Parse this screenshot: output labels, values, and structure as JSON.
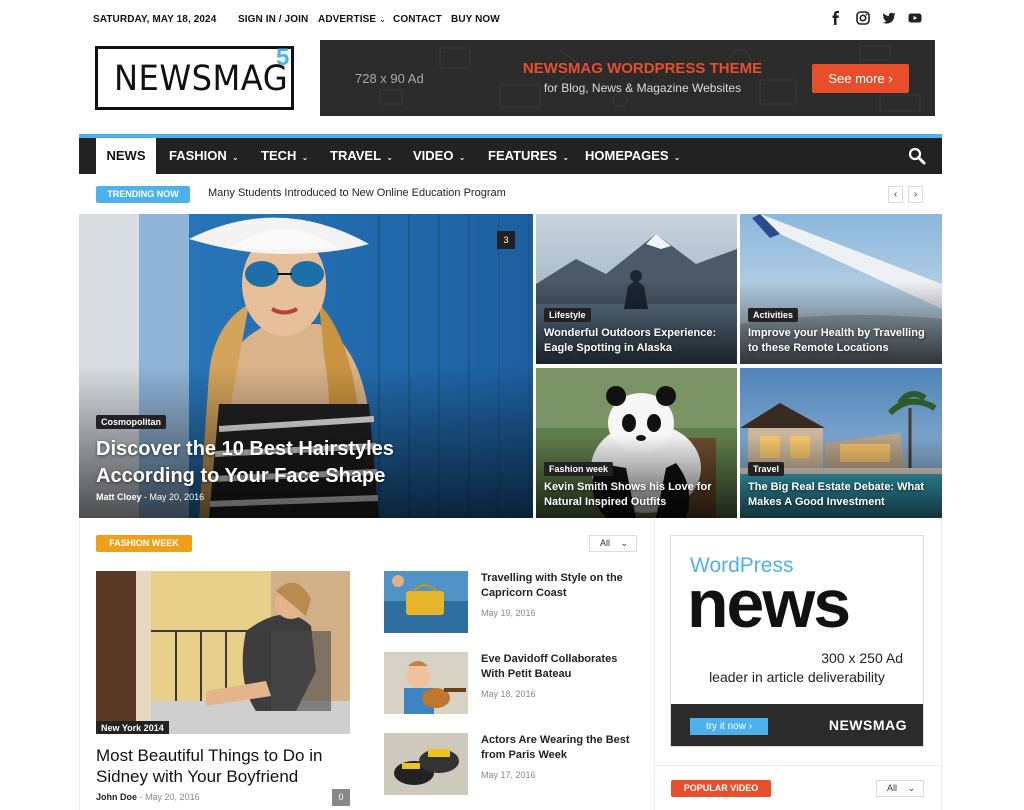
{
  "topbar": {
    "date": "SATURDAY, MAY 18, 2024",
    "links": [
      "SIGN IN / JOIN",
      "ADVERTISE",
      "CONTACT",
      "BUY NOW"
    ],
    "social_icons": [
      "facebook-icon",
      "instagram-icon",
      "twitter-icon",
      "youtube-icon"
    ]
  },
  "logo": {
    "text": "NEWSMAG",
    "sup": "5"
  },
  "ad_banner": {
    "size": "728 x 90 Ad",
    "title": "NEWSMAG WORDPRESS THEME",
    "subtitle": "for Blog, News & Magazine Websites",
    "button": "See more ›"
  },
  "nav": {
    "items": [
      "NEWS",
      "FASHION",
      "TECH",
      "TRAVEL",
      "VIDEO",
      "FEATURES",
      "HOMEPAGES"
    ]
  },
  "trending": {
    "label": "TRENDING NOW",
    "headline": "Many Students Introduced to New Online Education Program",
    "prev": "‹",
    "next": "›"
  },
  "hero": {
    "main": {
      "category": "Cosmopolitan",
      "title_line1": "Discover the 10 Best Hairstyles",
      "title_line2": "According to Your Face Shape",
      "author": "Matt Cloey",
      "date": "May 20, 2016",
      "comments": "3"
    },
    "tiles": [
      {
        "category": "Lifestyle",
        "line1": "Wonderful Outdoors Experience:",
        "line2": "Eagle Spotting in Alaska"
      },
      {
        "category": "Activities",
        "line1": "Improve your Health by Travelling",
        "line2": "to these Remote Locations"
      },
      {
        "category": "Fashion week",
        "line1": "Kevin Smith Shows his Love for",
        "line2": "Natural Inspired Outfits"
      },
      {
        "category": "Travel",
        "line1": "The Big Real Estate Debate: What",
        "line2": "Makes A Good Investment"
      }
    ]
  },
  "fashion_week": {
    "badge": "FASHION WEEK",
    "filter": "All",
    "main": {
      "image_label": "New York 2014",
      "title_line1": "Most Beautiful Things to Do in",
      "title_line2": "Sidney with Your Boyfriend",
      "author": "John Doe",
      "date": "May 20, 2016",
      "comments": "0"
    },
    "side": [
      {
        "line1": "Travelling with Style on the",
        "line2": "Capricorn Coast",
        "date": "May 19, 2016"
      },
      {
        "line1": "Eve Davidoff Collaborates",
        "line2": "With Petit Bateau",
        "date": "May 18, 2016"
      },
      {
        "line1": "Actors Are Wearing the Best",
        "line2": "from Paris Week",
        "date": "May 17, 2016"
      }
    ]
  },
  "side_ad": {
    "wordpress": "WordPress",
    "news": "news",
    "size": "300 x 250 Ad",
    "tagline": "leader in article deliverability",
    "button": "try it now ›",
    "brand": "NEWSMAG"
  },
  "popular_video": {
    "badge": "POPULAR VIDEO",
    "filter": "All"
  },
  "colors": {
    "accent": "#4db2ec",
    "orange": "#e94e2c",
    "badge_orange": "#f0a018",
    "dark": "#222222"
  }
}
